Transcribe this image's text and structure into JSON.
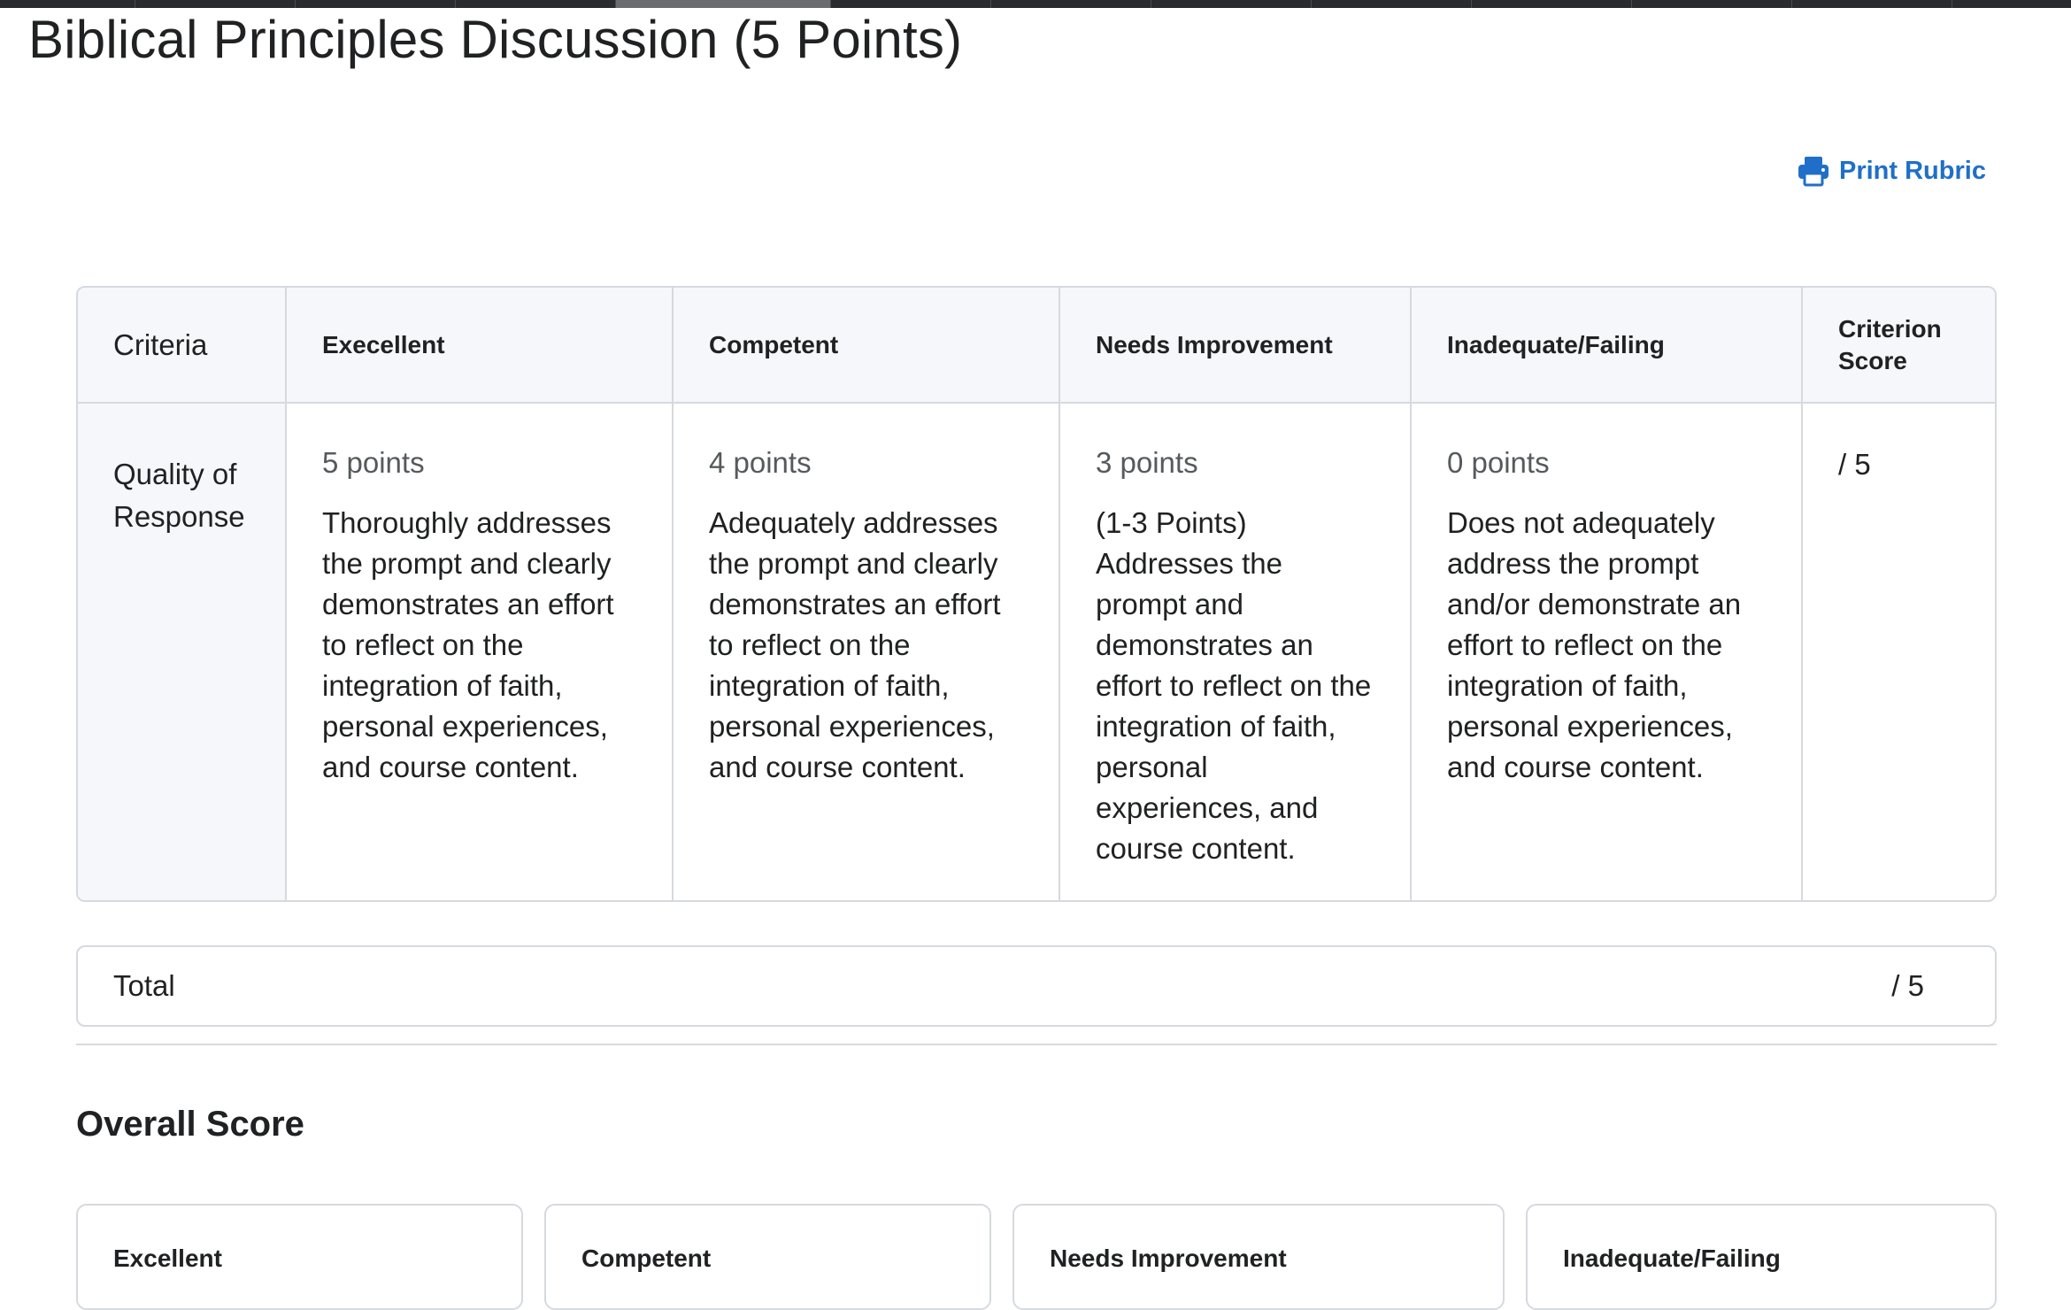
{
  "page": {
    "title": "Biblical Principles Discussion (5 Points)"
  },
  "toolbar": {
    "print_label": "Print Rubric",
    "print_icon": "printer-icon",
    "link_color": "#1f6fc9"
  },
  "rubric": {
    "headers": {
      "criteria": "Criteria",
      "levels": [
        "Execellent",
        "Competent",
        "Needs Improvement",
        "Inadequate/Failing"
      ],
      "score": "Criterion Score"
    },
    "rows": [
      {
        "criterion": "Quality of Response",
        "cells": [
          {
            "points": "5 points",
            "description": "Thoroughly addresses the prompt and clearly demonstrates an effort to reflect on the integration of faith, personal experiences, and course content."
          },
          {
            "points": "4 points",
            "description": "Adequately addresses the prompt and clearly demonstrates an effort to reflect on the integration of faith, personal experiences, and course content."
          },
          {
            "points": "3 points",
            "description": "(1-3 Points) Addresses the prompt and demonstrates an effort to reflect on the integration of faith, personal experiences, and course content."
          },
          {
            "points": "0 points",
            "description": "Does not adequately address the prompt and/or demonstrate an effort to reflect on the integration of faith, personal experiences, and course content."
          }
        ],
        "score": "/ 5"
      }
    ],
    "total_label": "Total",
    "total_score": "/ 5"
  },
  "overall": {
    "title": "Overall Score",
    "levels": [
      "Excellent",
      "Competent",
      "Needs Improvement",
      "Inadequate/Failing"
    ]
  }
}
